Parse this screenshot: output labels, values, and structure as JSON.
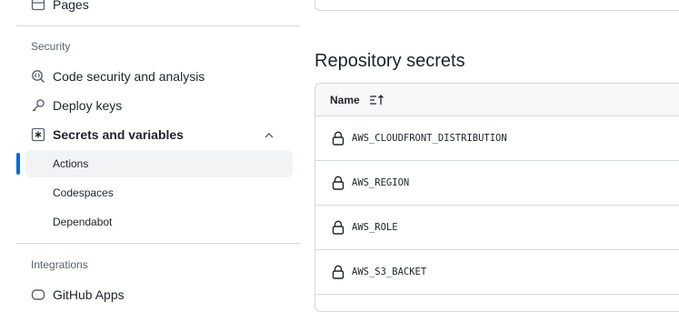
{
  "sidebar": {
    "pages_label": "Pages",
    "security_heading": "Security",
    "items": [
      {
        "label": "Code security and analysis",
        "icon": "codescan-icon"
      },
      {
        "label": "Deploy keys",
        "icon": "key-icon"
      },
      {
        "label": "Secrets and variables",
        "icon": "asterisk-icon",
        "expanded": true
      }
    ],
    "subitems": [
      {
        "label": "Actions",
        "active": true
      },
      {
        "label": "Codespaces",
        "active": false
      },
      {
        "label": "Dependabot",
        "active": false
      }
    ],
    "integrations_heading": "Integrations",
    "github_apps_label": "GitHub Apps"
  },
  "main": {
    "title": "Repository secrets",
    "table": {
      "column_name": "Name",
      "rows": [
        "AWS_CLOUDFRONT_DISTRIBUTION",
        "AWS_REGION",
        "AWS_ROLE",
        "AWS_S3_BACKET"
      ]
    }
  },
  "colors": {
    "accent": "#0969da",
    "active_bg": "#f1f3f5",
    "border": "#d1d9e0",
    "muted_text": "#59636e"
  }
}
